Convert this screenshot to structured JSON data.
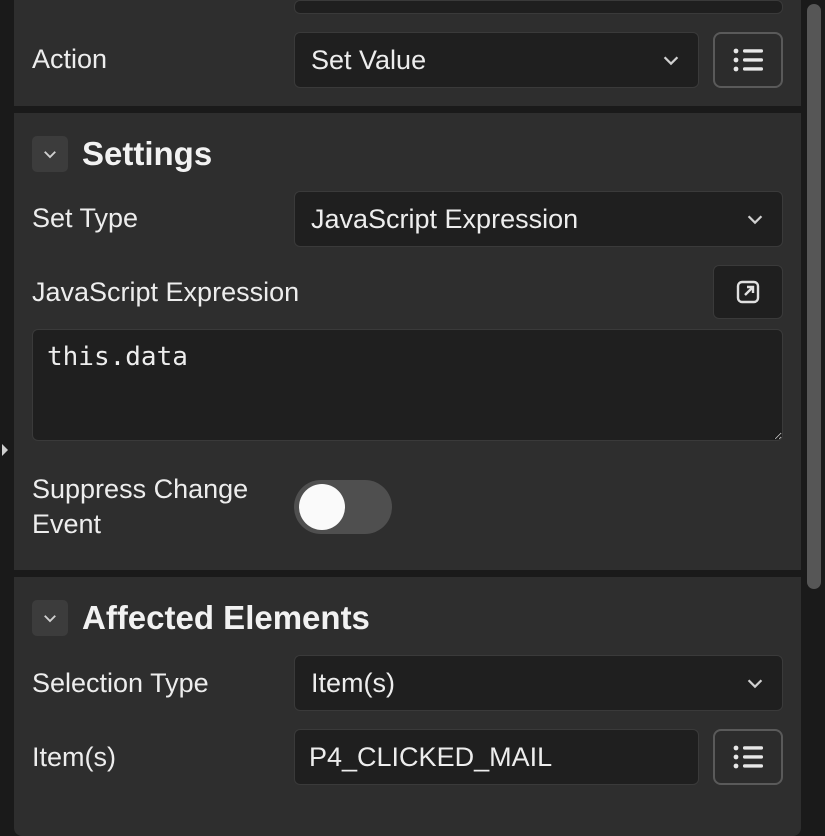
{
  "top": {
    "action_label": "Action",
    "action_value": "Set Value"
  },
  "settings": {
    "title": "Settings",
    "set_type_label": "Set Type",
    "set_type_value": "JavaScript Expression",
    "js_expr_label": "JavaScript Expression",
    "js_expr_value": "this.data",
    "suppress_label": "Suppress Change Event"
  },
  "affected": {
    "title": "Affected Elements",
    "selection_type_label": "Selection Type",
    "selection_type_value": "Item(s)",
    "items_label": "Item(s)",
    "items_value": "P4_CLICKED_MAIL"
  }
}
